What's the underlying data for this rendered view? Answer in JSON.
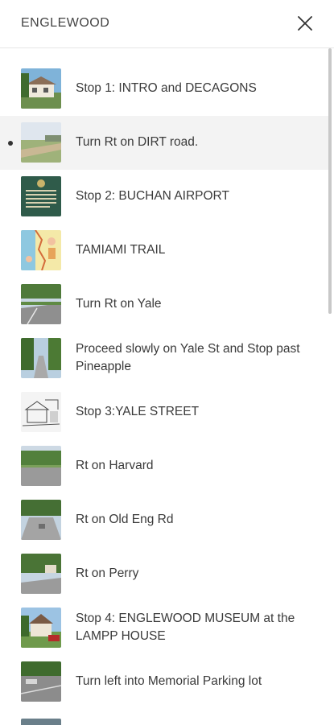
{
  "header": {
    "title": "ENGLEWOOD"
  },
  "stops": [
    {
      "label": "Stop 1: INTRO and DECAGONS",
      "icon": "house-photo-thumb",
      "active": false
    },
    {
      "label": "Turn Rt on DIRT road.",
      "icon": "dirt-road-photo-thumb",
      "active": true
    },
    {
      "label": "Stop 2: BUCHAN AIRPORT",
      "icon": "historic-marker-photo-thumb",
      "active": false
    },
    {
      "label": "TAMIAMI TRAIL",
      "icon": "map-illustration-thumb",
      "active": false
    },
    {
      "label": "Turn Rt on Yale",
      "icon": "street-photo-thumb",
      "active": false
    },
    {
      "label": "Proceed slowly on Yale St and Stop past Pineapple",
      "icon": "tree-lined-street-thumb",
      "active": false
    },
    {
      "label": "Stop 3:YALE STREET",
      "icon": "sketch-drawing-thumb",
      "active": false
    },
    {
      "label": "Rt on Harvard",
      "icon": "street-photo-thumb",
      "active": false
    },
    {
      "label": "Rt on Old Eng Rd",
      "icon": "road-photo-thumb",
      "active": false
    },
    {
      "label": "Rt on Perry",
      "icon": "street-photo-thumb",
      "active": false
    },
    {
      "label": "Stop 4: ENGLEWOOD MUSEUM at the LAMPP HOUSE",
      "icon": "museum-house-photo-thumb",
      "active": false
    },
    {
      "label": "Turn left into Memorial Parking lot",
      "icon": "parking-lot-photo-thumb",
      "active": false
    }
  ]
}
